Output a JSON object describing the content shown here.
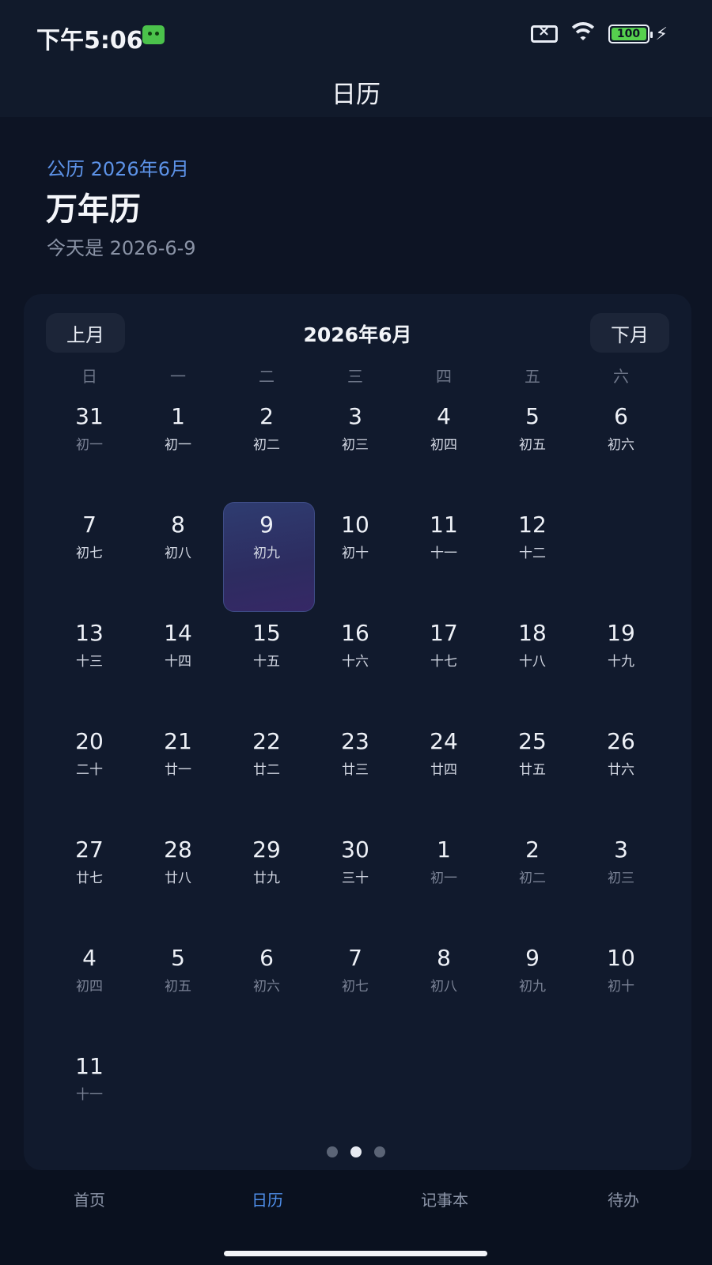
{
  "status_bar": {
    "time": "下午5:06",
    "battery": "100"
  },
  "app_bar": {
    "title": "日历"
  },
  "header": {
    "subtitle": "公历 2026年6月",
    "title": "万年历",
    "today": "今天是 2026-6-9"
  },
  "calendar": {
    "prev_label": "上月",
    "next_label": "下月",
    "month_title": "2026年6月",
    "weekdays": [
      "日",
      "一",
      "二",
      "三",
      "四",
      "五",
      "六"
    ],
    "days": [
      {
        "n": "31",
        "l": "初一",
        "other": true
      },
      {
        "n": "1",
        "l": "初一"
      },
      {
        "n": "2",
        "l": "初二"
      },
      {
        "n": "3",
        "l": "初三"
      },
      {
        "n": "4",
        "l": "初四"
      },
      {
        "n": "5",
        "l": "初五"
      },
      {
        "n": "6",
        "l": "初六"
      },
      {
        "n": "7",
        "l": "初七"
      },
      {
        "n": "8",
        "l": "初八"
      },
      {
        "n": "9",
        "l": "初九",
        "selected": true
      },
      {
        "n": "10",
        "l": "初十"
      },
      {
        "n": "11",
        "l": "十一"
      },
      {
        "n": "12",
        "l": "十二"
      },
      {
        "n": "",
        "l": "",
        "empty": true
      },
      {
        "n": "13",
        "l": "十三"
      },
      {
        "n": "14",
        "l": "十四"
      },
      {
        "n": "15",
        "l": "十五"
      },
      {
        "n": "16",
        "l": "十六"
      },
      {
        "n": "17",
        "l": "十七"
      },
      {
        "n": "18",
        "l": "十八"
      },
      {
        "n": "19",
        "l": "十九"
      },
      {
        "n": "20",
        "l": "二十"
      },
      {
        "n": "21",
        "l": "廿一"
      },
      {
        "n": "22",
        "l": "廿二"
      },
      {
        "n": "23",
        "l": "廿三"
      },
      {
        "n": "24",
        "l": "廿四"
      },
      {
        "n": "25",
        "l": "廿五"
      },
      {
        "n": "26",
        "l": "廿六"
      },
      {
        "n": "27",
        "l": "廿七"
      },
      {
        "n": "28",
        "l": "廿八"
      },
      {
        "n": "29",
        "l": "廿九"
      },
      {
        "n": "30",
        "l": "三十"
      },
      {
        "n": "1",
        "l": "初一",
        "other": true
      },
      {
        "n": "2",
        "l": "初二",
        "other": true
      },
      {
        "n": "3",
        "l": "初三",
        "other": true
      },
      {
        "n": "4",
        "l": "初四",
        "other": true
      },
      {
        "n": "5",
        "l": "初五",
        "other": true
      },
      {
        "n": "6",
        "l": "初六",
        "other": true
      },
      {
        "n": "7",
        "l": "初七",
        "other": true
      },
      {
        "n": "8",
        "l": "初八",
        "other": true
      },
      {
        "n": "9",
        "l": "初九",
        "other": true
      },
      {
        "n": "10",
        "l": "初十",
        "other": true
      },
      {
        "n": "11",
        "l": "十一",
        "other": true
      }
    ]
  },
  "tabs": [
    {
      "label": "首页"
    },
    {
      "label": "日历",
      "active": true
    },
    {
      "label": "记事本"
    },
    {
      "label": "待办"
    }
  ],
  "colors": {
    "accent": "#4f8fea",
    "background": "#0d1424",
    "card": "#111a2d",
    "selected": "#2e3c70"
  }
}
